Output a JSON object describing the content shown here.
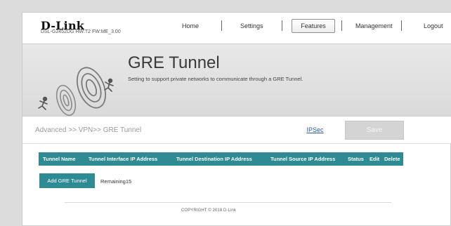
{
  "brand": {
    "logo": "D-Link",
    "model_info": "DSL-G2452DG  HW:T2  FW:ME_3.00"
  },
  "nav": {
    "home": "Home",
    "settings": "Settings",
    "features": "Features",
    "management": "Management",
    "logout": "Logout",
    "active": "Features"
  },
  "banner": {
    "title": "GRE Tunnel",
    "description": "Setting to support private networks to communicate through a GRE Tunnel."
  },
  "breadcrumb": "Advanced >> VPN>> GRE Tunnel",
  "actions": {
    "ipsec_link": "IPSec",
    "save_label": "Save"
  },
  "table": {
    "columns": [
      "Tunnel Name",
      "Tunnel Interface IP Address",
      "Tunnel Destination IP Address",
      "Tunnel Source IP Address",
      "Status",
      "Edit",
      "Delete"
    ],
    "rows": []
  },
  "add_button_label": "Add GRE Tunnel",
  "remaining_text": "Remaining15",
  "footer": {
    "copyright": "COPYRIGHT © 2018 D-Link"
  },
  "colors": {
    "accent": "#2e8b94",
    "save_disabled": "#d4d4d4",
    "link": "#2a5a9e"
  },
  "icons": [
    "banner-runner-circles-illustration"
  ]
}
